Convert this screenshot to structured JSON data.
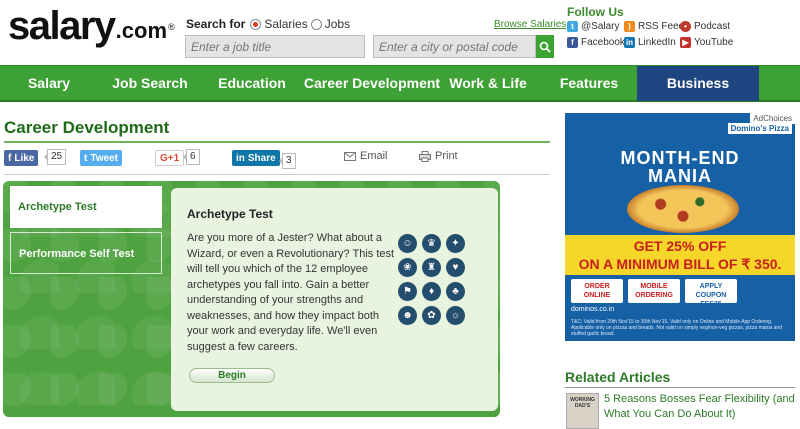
{
  "header": {
    "logo_main": "salary",
    "logo_com": ".com",
    "logo_reg": "®",
    "search_label": "Search for",
    "radio_salaries": "Salaries",
    "radio_jobs": "Jobs",
    "browse_link": "Browse Salaries",
    "job_placeholder": "Enter a job title",
    "location_placeholder": "Enter a city or postal code"
  },
  "follow": {
    "title": "Follow Us",
    "items": [
      {
        "label": "@Salary",
        "icon": "twitter-icon"
      },
      {
        "label": "RSS Feed",
        "icon": "rss-icon"
      },
      {
        "label": "Podcast",
        "icon": "podcast-icon"
      },
      {
        "label": "Facebook",
        "icon": "facebook-icon"
      },
      {
        "label": "LinkedIn",
        "icon": "linkedin-icon"
      },
      {
        "label": "YouTube",
        "icon": "youtube-icon"
      }
    ]
  },
  "nav": {
    "items": [
      {
        "label": "Salary"
      },
      {
        "label": "Job Search"
      },
      {
        "label": "Education"
      },
      {
        "label": "Career Development"
      },
      {
        "label": "Work & Life"
      },
      {
        "label": "Features"
      },
      {
        "label": "Business Products"
      }
    ],
    "active_color": "#1f4580"
  },
  "page": {
    "title": "Career Development"
  },
  "share": {
    "facebook_label": "Like",
    "facebook_count": "25",
    "twitter_label": "Tweet",
    "gplus_label": "G+1",
    "gplus_count": "6",
    "linkedin_label": "Share",
    "linkedin_count": "3",
    "email_label": "Email",
    "print_label": "Print"
  },
  "tabs": [
    {
      "label": "Archetype Test"
    },
    {
      "label": "Performance Self Test"
    }
  ],
  "content": {
    "title": "Archetype Test",
    "description": "Are you more of a Jester? What about a Wizard, or even a Revolutionary? This test will tell you which of the 12 employee archetypes you fall into. Gain a better understanding of your strengths and weaknesses, and how they impact both your work and everyday life. We'll even suggest a few careers.",
    "begin_label": "Begin"
  },
  "ad": {
    "adchoices": "AdChoices",
    "brand": "Domino's Pizza",
    "headline_1": "MONTH-END",
    "headline_2": "MANIA",
    "offer_1": "GET 25% OFF",
    "offer_2": "ON A MINIMUM BILL OF ₹ 350.",
    "btn_1": "ORDER ONLINE",
    "btn_2": "MOBILE ORDERING",
    "btn_3": "APPLY COUPON FES25",
    "url": "dominos.co.in",
    "fine_print": "T&C: Valid from 29th Nov'15 to 30th Nov'15. Valid only on Online and Mobile App Ordering. Applicable only on pizzas and breads. Not valid on simply veg/non-veg pizzas, pizza mania and stuffed garlic bread."
  },
  "related": {
    "title": "Related Articles",
    "thumb_text": "WORKING DAD'S",
    "article_1": "5 Reasons Bosses Fear Flexibility (and What You Can Do About It)"
  }
}
